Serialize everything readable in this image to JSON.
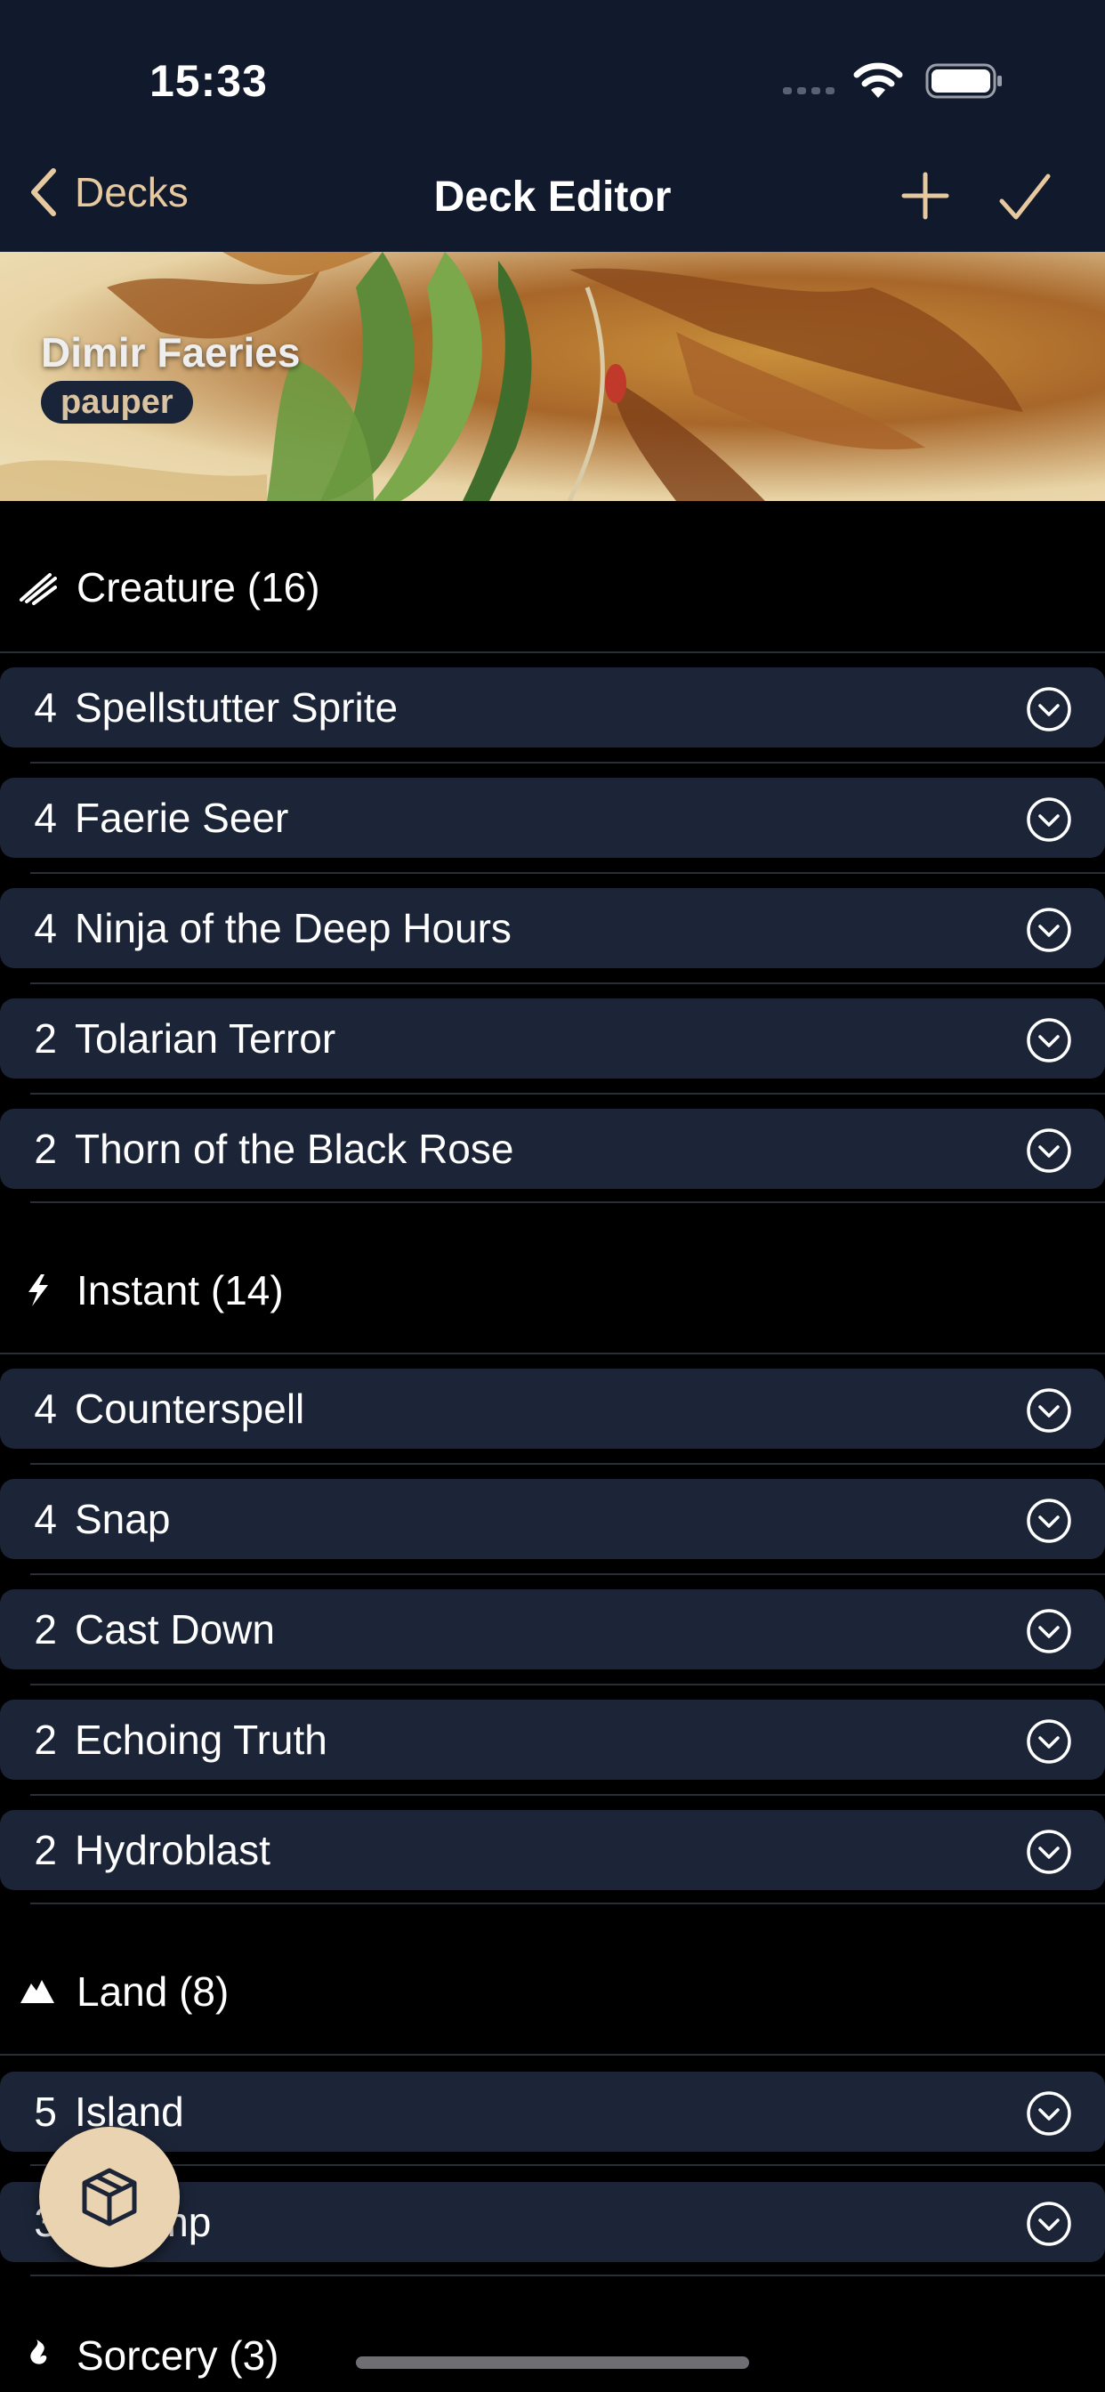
{
  "status_bar": {
    "time": "15:33"
  },
  "nav": {
    "back_label": "Decks",
    "title": "Deck Editor"
  },
  "deck": {
    "name": "Dimir Faeries",
    "format": "pauper"
  },
  "sections": [
    {
      "type": "Creature",
      "count": 16,
      "label": "Creature (16)",
      "icon": "creature-claw-icon",
      "cards": [
        {
          "qty": "4",
          "name": "Spellstutter Sprite"
        },
        {
          "qty": "4",
          "name": "Faerie Seer"
        },
        {
          "qty": "4",
          "name": "Ninja of the Deep Hours"
        },
        {
          "qty": "2",
          "name": "Tolarian Terror"
        },
        {
          "qty": "2",
          "name": "Thorn of the Black Rose"
        }
      ]
    },
    {
      "type": "Instant",
      "count": 14,
      "label": "Instant (14)",
      "icon": "instant-bolt-icon",
      "cards": [
        {
          "qty": "4",
          "name": "Counterspell"
        },
        {
          "qty": "4",
          "name": "Snap"
        },
        {
          "qty": "2",
          "name": "Cast Down"
        },
        {
          "qty": "2",
          "name": "Echoing Truth"
        },
        {
          "qty": "2",
          "name": "Hydroblast"
        }
      ]
    },
    {
      "type": "Land",
      "count": 8,
      "label": "Land (8)",
      "icon": "land-mountain-icon",
      "cards": [
        {
          "qty": "5",
          "name": "Island"
        },
        {
          "qty": "3",
          "name": "Swamp"
        }
      ]
    },
    {
      "type": "Sorcery",
      "count": 3,
      "label": "Sorcery (3)",
      "icon": "sorcery-flame-icon",
      "cards": []
    }
  ],
  "colors": {
    "nav_bg": "#111a2c",
    "row_bg": "#1c2538",
    "accent": "#e7c9a0",
    "fab_bg": "#ead3b0"
  }
}
